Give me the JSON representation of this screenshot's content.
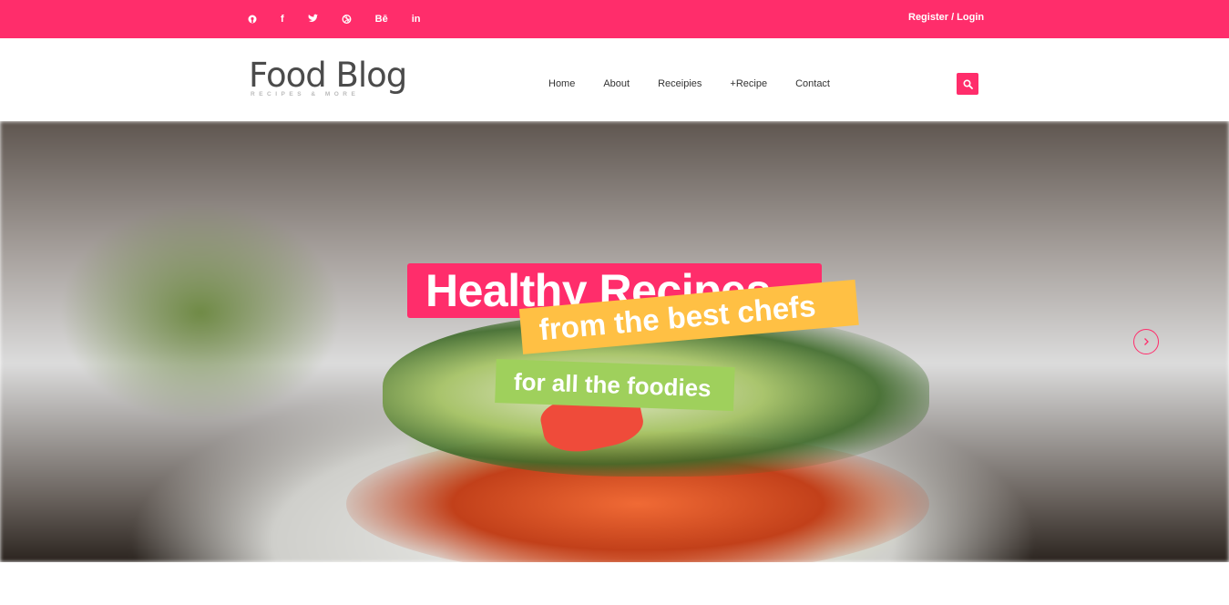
{
  "topbar": {
    "social": [
      {
        "icon": "pinterest-icon",
        "glyph": "Ⓟ"
      },
      {
        "icon": "facebook-icon",
        "glyph": "f"
      },
      {
        "icon": "twitter-icon",
        "glyph": "t"
      },
      {
        "icon": "dribbble-icon",
        "glyph": "◎"
      },
      {
        "icon": "behance-icon",
        "glyph": "Bē"
      },
      {
        "icon": "linkedin-icon",
        "glyph": "in"
      }
    ],
    "register_login": "Register / Login"
  },
  "header": {
    "logo_title": "Food Blog",
    "logo_tagline": "RECIPES & MORE",
    "nav": [
      "Home",
      "About",
      "Receipies",
      "+Recipe",
      "Contact"
    ]
  },
  "hero": {
    "headline": "Healthy Recipes",
    "line2": "from the best chefs",
    "line3": "for all the foodies"
  },
  "colors": {
    "accent": "#ff2d6b",
    "yellow": "#ffc044",
    "green": "#9fd05c"
  }
}
